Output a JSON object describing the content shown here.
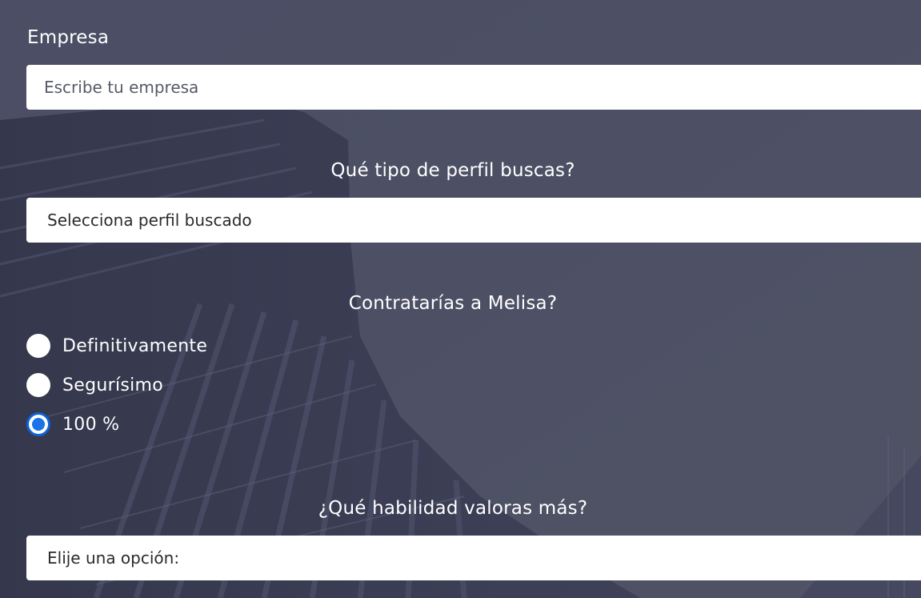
{
  "company": {
    "label": "Empresa",
    "placeholder": "Escribe tu empresa"
  },
  "profile": {
    "label": "Qué tipo de perfil buscas?",
    "selected": "Selecciona perfil buscado"
  },
  "hire": {
    "label": "Contratarías a Melisa?",
    "options": [
      {
        "label": "Definitivamente",
        "checked": false
      },
      {
        "label": "Segurísimo",
        "checked": false
      },
      {
        "label": "100 %",
        "checked": true
      }
    ]
  },
  "skill": {
    "label": "¿Qué habilidad valoras más?",
    "selected": "Elije una opción:"
  },
  "colors": {
    "overlay": "#474a62",
    "radio_checked": "#1a73e8",
    "field_bg": "#ffffff"
  }
}
